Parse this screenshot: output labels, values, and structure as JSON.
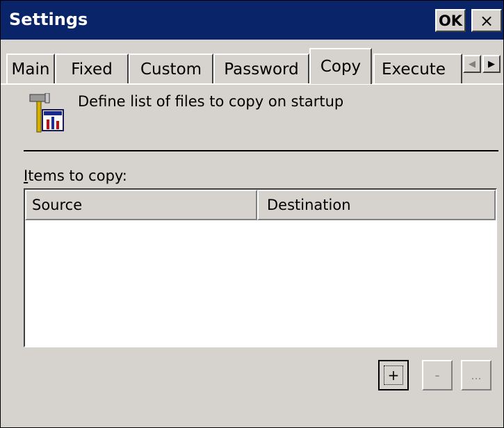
{
  "window": {
    "title": "Settings",
    "ok_label": "OK",
    "close_label": "×"
  },
  "tabs": [
    {
      "label": "Main",
      "active": false
    },
    {
      "label": "Fixed",
      "active": false
    },
    {
      "label": "Custom",
      "active": false
    },
    {
      "label": "Password",
      "active": false
    },
    {
      "label": "Copy",
      "active": true
    },
    {
      "label": "Execute",
      "active": false
    }
  ],
  "tab_scroll": {
    "left": "◀",
    "right": "▶"
  },
  "header": {
    "icon": "settings-tools-icon",
    "description": "Define list of files to copy on startup"
  },
  "items": {
    "label_accel": "I",
    "label_rest": "tems to copy:",
    "columns": [
      "Source",
      "Destination"
    ],
    "rows": []
  },
  "buttons": {
    "add": "+",
    "remove": "-",
    "more": "..."
  },
  "colors": {
    "titlebar": "#0a246a",
    "face": "#d6d3ce"
  }
}
